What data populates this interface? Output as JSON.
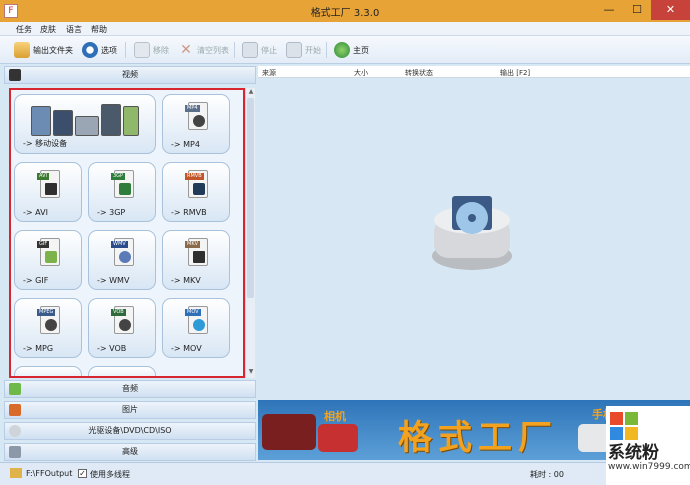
{
  "window": {
    "title": "格式工厂 3.3.0",
    "min": "—",
    "max": "☐",
    "close": "✕",
    "app_icon": "F"
  },
  "menu": [
    "任务",
    "皮肤",
    "语言",
    "帮助"
  ],
  "toolbar": {
    "output_folder": "输出文件夹",
    "options": "选项",
    "remove": "移除",
    "clear_list": "清空列表",
    "stop": "停止",
    "start": "开始",
    "home": "主页"
  },
  "categories": {
    "video": "视频",
    "audio": "音频",
    "image": "图片",
    "disc": "光驱设备\\DVD\\CD\\ISO",
    "advanced": "高级"
  },
  "formats": [
    {
      "label": "-> 移动设备",
      "tag": ""
    },
    {
      "label": "-> MP4",
      "tag": "MP4",
      "color": "#5a6f8a"
    },
    {
      "label": "-> AVI",
      "tag": "AVI",
      "color": "#3c7a2e"
    },
    {
      "label": "-> 3GP",
      "tag": "3GP",
      "color": "#2f7d3a"
    },
    {
      "label": "-> RMVB",
      "tag": "RMVB",
      "color": "#c2552a"
    },
    {
      "label": "-> GIF",
      "tag": "GIF",
      "color": "#333333"
    },
    {
      "label": "-> WMV",
      "tag": "WMV",
      "color": "#2d4d8a"
    },
    {
      "label": "-> MKV",
      "tag": "MKV",
      "color": "#8a6a4a"
    },
    {
      "label": "-> MPG",
      "tag": "MPEG",
      "color": "#3a5a8a"
    },
    {
      "label": "-> VOB",
      "tag": "VOB",
      "color": "#2f6b3a"
    },
    {
      "label": "-> MOV",
      "tag": "MOV",
      "color": "#2f6fb8"
    }
  ],
  "list_columns": [
    "来源",
    "大小",
    "转换状态",
    "输出 [F2]"
  ],
  "banner": {
    "brand": "格式工厂",
    "camera_label": "相机",
    "phone_label": "手机"
  },
  "status": {
    "output_path": "F:\\FFOutput",
    "multithread_label": "使用多线程",
    "multithread_checked": "✓",
    "elapsed": "耗时 : 00"
  },
  "watermark": {
    "name": "系统粉",
    "url": "www.win7999.com"
  }
}
